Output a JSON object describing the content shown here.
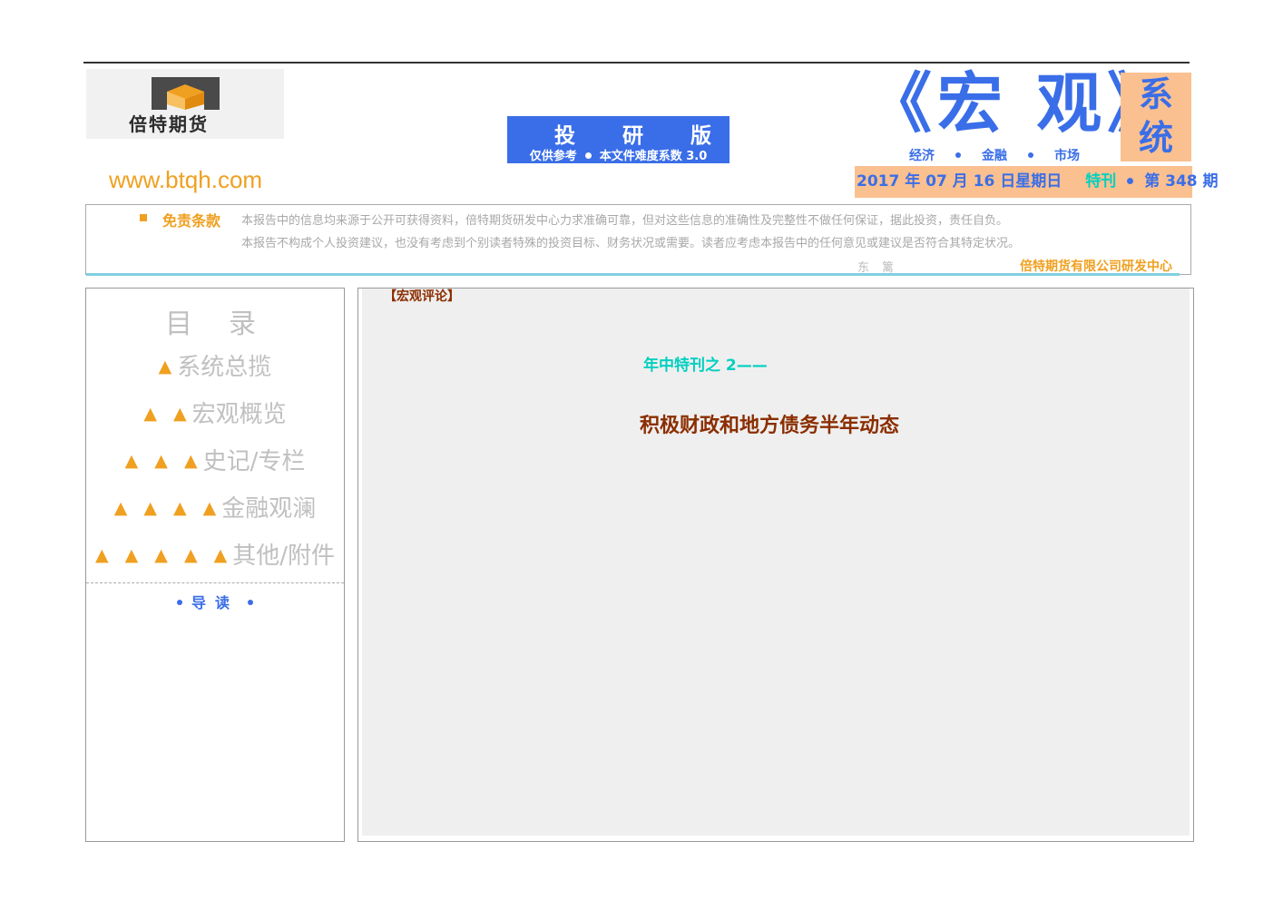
{
  "header": {
    "logo_text": "倍特期货",
    "website": "www.btqh.com",
    "edition": {
      "title": "投研版",
      "note": "仅供参考",
      "difficulty": "本文件难度系数 3.0"
    },
    "big_title": "《宏 观》",
    "title_tags": [
      "经济",
      "金融",
      "市场"
    ],
    "system_label": "系统",
    "date": "2017 年 07 月 16 日星期日",
    "special_label": "特刊",
    "issue": "第 348 期"
  },
  "disclaimer": {
    "label": "免责条款",
    "text_line1": "本报告中的信息均来源于公开可获得资料，倍特期货研发中心力求准确可靠，但对这些信息的准确性及完整性不做任何保证，据此投资，责任自负。",
    "text_line2": "本报告不构成个人投资建议，也没有考虑到个别读者特殊的投资目标、财务状况或需要。读者应考虑本报告中的任何意见或建议是否符合其特定状况。",
    "author": "东篱",
    "company": "倍特期货有限公司研发中心"
  },
  "toc": {
    "title": "目录",
    "items": [
      {
        "marker": "▲",
        "label": "系统总揽"
      },
      {
        "marker": "▲ ▲",
        "label": "宏观概览"
      },
      {
        "marker": "▲ ▲ ▲",
        "label": "史记/专栏"
      },
      {
        "marker": "▲ ▲ ▲ ▲",
        "label": "金融观澜"
      },
      {
        "marker": "▲ ▲ ▲ ▲ ▲",
        "label": "其他/附件"
      }
    ],
    "guide": "导读"
  },
  "main": {
    "section_tag": "【宏观评论】",
    "special_line": "年中特刊之 2——",
    "headline": "积极财政和地方债务半年动态"
  },
  "colors": {
    "blue": "#3a6ee8",
    "orange": "#f0a020",
    "peach": "#fac090",
    "cyan": "#00d0c0",
    "brown": "#8b2e00"
  }
}
